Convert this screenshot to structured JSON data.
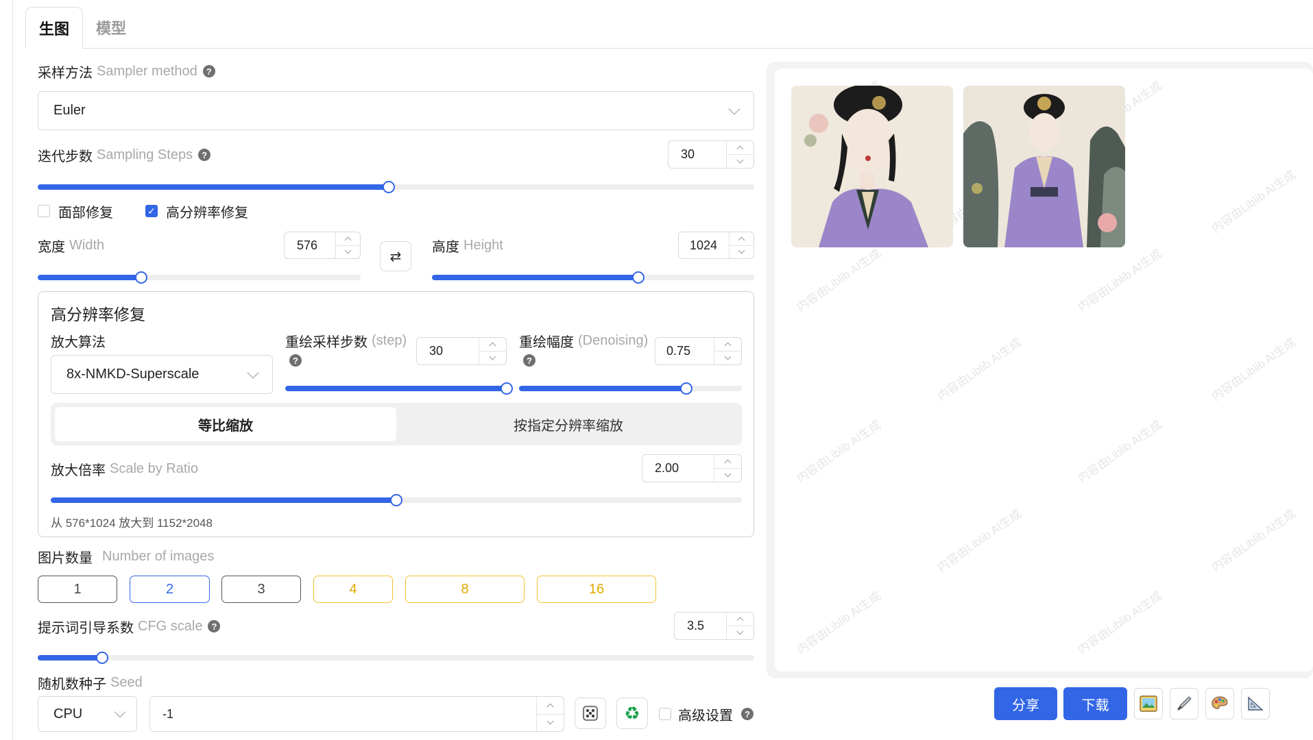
{
  "tabs": {
    "generate": "生图",
    "model": "模型"
  },
  "sampler": {
    "label_cn": "采样方法",
    "label_en": "Sampler method",
    "value": "Euler"
  },
  "steps": {
    "label_cn": "迭代步数",
    "label_en": "Sampling Steps",
    "value": "30",
    "fraction": 0.49
  },
  "restore": {
    "face_label": "面部修复",
    "face_checked": false,
    "hires_label": "高分辨率修复",
    "hires_checked": true
  },
  "width": {
    "label_cn": "宽度",
    "label_en": "Width",
    "value": "576",
    "fraction": 0.32
  },
  "height": {
    "label_cn": "高度",
    "label_en": "Height",
    "value": "1024",
    "fraction": 0.64
  },
  "swap_icon": "swap-arrows-icon",
  "hires": {
    "title": "高分辨率修复",
    "upscaler_label": "放大算法",
    "upscaler_value": "8x-NMKD-Superscale",
    "resample_label_cn": "重绘采样步数",
    "resample_label_en": "(step)",
    "resample_value": "30",
    "resample_fraction": 1.0,
    "denoise_label_cn": "重绘幅度",
    "denoise_label_en": "(Denoising)",
    "denoise_value": "0.75",
    "denoise_fraction": 0.75,
    "mode_ratio": "等比缩放",
    "mode_resolution": "按指定分辨率缩放",
    "scale_label_cn": "放大倍率",
    "scale_label_en": "Scale by Ratio",
    "scale_value": "2.00",
    "scale_fraction": 0.5,
    "hint": "从 576*1024 放大到 1152*2048"
  },
  "images": {
    "label_cn": "图片数量",
    "label_en": "Number of images",
    "options": [
      "1",
      "2",
      "3",
      "4",
      "8",
      "16"
    ],
    "selected": "2"
  },
  "cfg": {
    "label_cn": "提示词引导系数",
    "label_en": "CFG scale",
    "value": "3.5",
    "fraction": 0.09
  },
  "seed": {
    "label_cn": "随机数种子",
    "label_en": "Seed",
    "device": "CPU",
    "value": "-1",
    "advanced_label": "高级设置"
  },
  "watermark": "内容由Liblib AI生成",
  "actions": {
    "share": "分享",
    "download": "下载"
  },
  "colors": {
    "accent": "#3366e6",
    "gold": "#f2c230",
    "robe": "#9a86c8"
  }
}
